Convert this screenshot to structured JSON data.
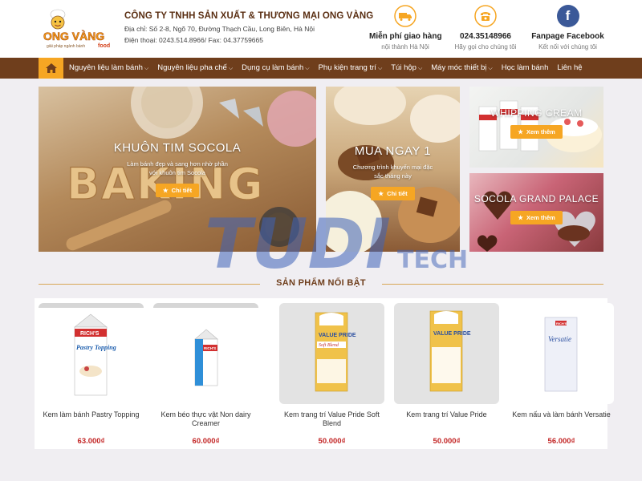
{
  "header": {
    "logo_top": "ONG VÀNG",
    "logo_tag": "giải pháp ngành bánh",
    "logo_suffix": "food",
    "company_name": "CÔNG TY TNHH SẢN XUẤT & THƯƠNG MẠI ONG VÀNG",
    "address": "Địa chỉ: Số 2-8, Ngõ 70, Đường Thạch Cầu, Long Biên, Hà Nội",
    "phone_line": "Điện thoại: 0243.514.8966/ Fax: 04.37759665",
    "info": [
      {
        "title": "Miễn phí giao hàng",
        "sub": "nội thành Hà Nội",
        "icon": "truck-icon",
        "color": "#f6a623"
      },
      {
        "title": "024.35148966",
        "sub": "Hãy gọi cho chúng tôi",
        "icon": "phone-icon",
        "color": "#f6a623"
      },
      {
        "title": "Fanpage Facebook",
        "sub": "Kết nối với chúng tôi",
        "icon": "facebook-icon",
        "color": "#3b5998"
      }
    ]
  },
  "nav": {
    "items": [
      {
        "label": "Nguyên liệu làm bánh",
        "dropdown": true
      },
      {
        "label": "Nguyên liệu pha chế",
        "dropdown": true
      },
      {
        "label": "Dụng cụ làm bánh",
        "dropdown": true
      },
      {
        "label": "Phụ kiện trang trí",
        "dropdown": true
      },
      {
        "label": "Túi hộp",
        "dropdown": true
      },
      {
        "label": "Máy móc thiết bị",
        "dropdown": true
      },
      {
        "label": "Học làm bánh",
        "dropdown": false
      },
      {
        "label": "Liên hệ",
        "dropdown": false
      }
    ],
    "accent": "#f6a623",
    "bar_color": "#6f3e1c"
  },
  "banners": [
    {
      "title": "KHUÔN TIM SOCOLA",
      "sub1": "Làm bánh đẹp và sang hơn nhờ phần",
      "sub2": "với khuôn tim Socola",
      "button": "Chi tiết",
      "art": "BAKING"
    },
    {
      "title": "MUA NGAY 1",
      "sub1": "Chương trình khuyến mại đặc",
      "sub2": "sắc tháng này",
      "button": "Chi tiết"
    },
    {
      "title": "WHIPPING CREAM",
      "button": "Xem thêm"
    },
    {
      "title": "SOCOLA GRAND PALACE",
      "button": "Xem thêm"
    }
  ],
  "watermark": {
    "big": "TUDI",
    "small": "TECH"
  },
  "featured": {
    "heading": "SẢN PHẨM NỔI BẬT",
    "products": [
      {
        "name": "Kem làm bánh Pastry Topping",
        "price": "63.000₫",
        "brand": "RICH'S",
        "label": "Pastry Topping"
      },
      {
        "name": "Kem béo thực vật Non dairy Creamer",
        "price": "60.000₫",
        "brand": "RICH'S",
        "label": ""
      },
      {
        "name": "Kem trang trí Value Pride Soft Blend",
        "price": "50.000₫",
        "brand": "VALUE PRIDE",
        "label": "Soft Blend"
      },
      {
        "name": "Kem trang trí Value Pride",
        "price": "50.000₫",
        "brand": "VALUE PRIDE",
        "label": ""
      },
      {
        "name": "Kem nấu và làm bánh Versatie",
        "price": "56.000₫",
        "brand": "RICH'S",
        "label": "Versatie"
      }
    ],
    "price_color": "#c32626"
  }
}
